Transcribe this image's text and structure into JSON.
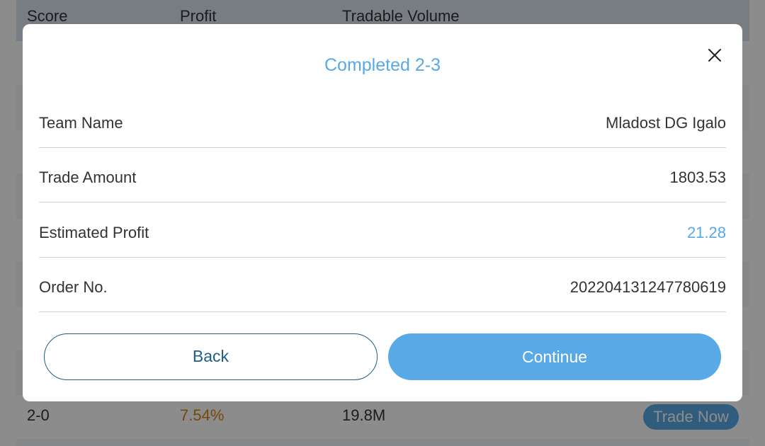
{
  "background_table": {
    "headers": {
      "score": "Score",
      "profit": "Profit",
      "volume": "Tradable Volume"
    },
    "visible_row": {
      "score": "2-0",
      "profit": "7.54%",
      "volume": "19.8M",
      "action": "Trade Now"
    }
  },
  "modal": {
    "title": "Completed 2-3",
    "close_icon": "close-icon",
    "rows": [
      {
        "label": "Team Name",
        "value": "Mladost DG Igalo"
      },
      {
        "label": "Trade Amount",
        "value": "1803.53"
      },
      {
        "label": "Estimated Profit",
        "value": "21.28"
      },
      {
        "label": "Order No.",
        "value": "202204131247780619"
      }
    ],
    "buttons": {
      "back": "Back",
      "continue": "Continue"
    }
  },
  "colors": {
    "accent": "#58a9e6",
    "dark_accent": "#1e5d87",
    "profit_text": "#d9820f",
    "overlay": "rgba(0,0,0,0.45)"
  }
}
